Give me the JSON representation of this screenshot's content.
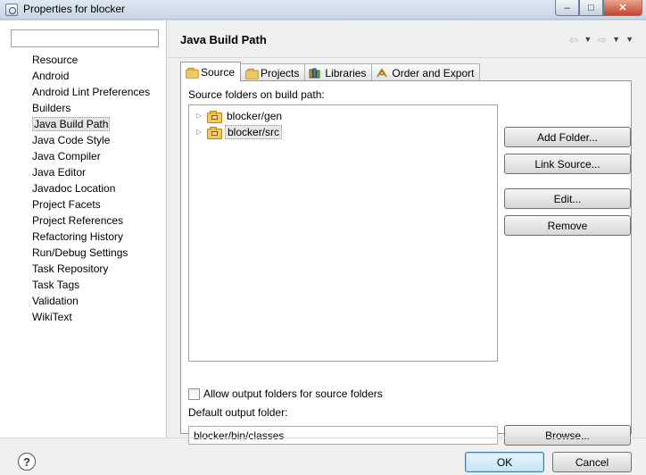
{
  "window": {
    "title": "Properties for blocker",
    "controls": {
      "minimize": "–",
      "maximize": "□",
      "close": "✕"
    }
  },
  "filter": {
    "value": "",
    "placeholder": ""
  },
  "nav": {
    "items": [
      "Resource",
      "Android",
      "Android Lint Preferences",
      "Builders",
      "Java Build Path",
      "Java Code Style",
      "Java Compiler",
      "Java Editor",
      "Javadoc Location",
      "Project Facets",
      "Project References",
      "Refactoring History",
      "Run/Debug Settings",
      "Task Repository",
      "Task Tags",
      "Validation",
      "WikiText"
    ],
    "selected_index": 4
  },
  "header": {
    "title": "Java Build Path",
    "nav_icons": [
      "back-arrow-icon",
      "forward-arrow-icon",
      "view-menu-icon"
    ]
  },
  "tabs": [
    {
      "label": "Source",
      "icon": "source-folder-icon",
      "active": true
    },
    {
      "label": "Projects",
      "icon": "projects-icon",
      "active": false
    },
    {
      "label": "Libraries",
      "icon": "libraries-icon",
      "active": false
    },
    {
      "label": "Order and Export",
      "icon": "order-export-icon",
      "active": false
    }
  ],
  "source": {
    "heading": "Source folders on build path:",
    "folders": [
      {
        "label": "blocker/gen",
        "selected": false
      },
      {
        "label": "blocker/src",
        "selected": true
      }
    ],
    "buttons": {
      "add_folder": "Add Folder...",
      "link_source": "Link Source...",
      "edit": "Edit...",
      "remove": "Remove",
      "browse": "Browse..."
    },
    "allow_output_label": "Allow output folders for source folders",
    "allow_output_checked": false,
    "default_output_label": "Default output folder:",
    "default_output_value": "blocker/bin/classes"
  },
  "footer": {
    "ok": "OK",
    "cancel": "Cancel",
    "help_icon": "?"
  },
  "colors": {
    "accent": "#3c7fb1",
    "folder": "#f1c866"
  }
}
